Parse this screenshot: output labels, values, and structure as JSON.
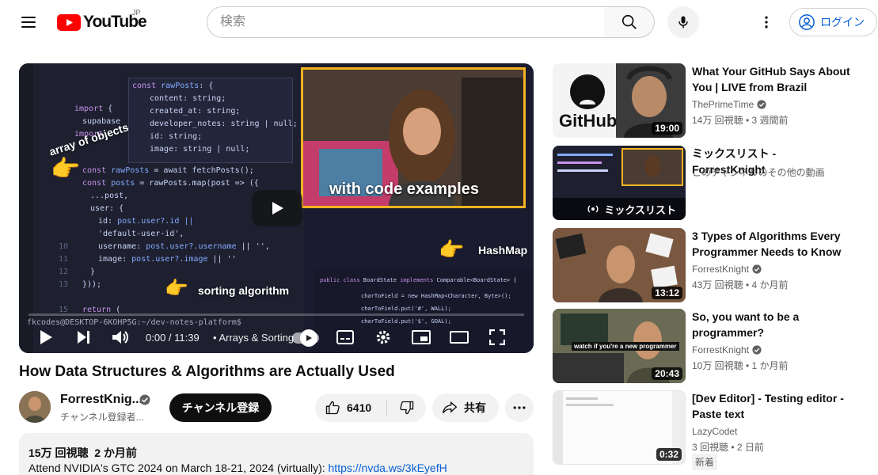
{
  "header": {
    "logo_text": "YouTube",
    "region": "JP",
    "search_placeholder": "検索",
    "login_label": "ログイン"
  },
  "player": {
    "overlay": {
      "array_label": "array of objects",
      "code_examples_label": "with code examples",
      "hashmap_label": "HashMap",
      "sorting_label": "sorting algorithm"
    },
    "time": "0:00 / 11:39",
    "chapter": "• Arrays & Sorting",
    "progress": 0,
    "terminal_prompt": "fkcodes@DESKTOP-6KOHP5G:~/dev-notes-platform$"
  },
  "video": {
    "title": "How Data Structures & Algorithms are Actually Used",
    "channel_name": "ForrestKnig...",
    "channel_subs": "チャンネル登録者...",
    "subscribe_label": "チャンネル登録",
    "like_count": "6410",
    "share_label": "共有"
  },
  "description": {
    "stats_views": "15万 回視聴",
    "stats_date": "2 か月前",
    "line_text": "Attend NVIDIA's GTC 2024 on March 18-21, 2024 (virtually): ",
    "line_link": "https://nvda.ws/3kEyefH"
  },
  "recommendations": [
    {
      "title": "What Your GitHub Says About You | LIVE from Brazil",
      "channel": "ThePrimeTime",
      "verified": true,
      "meta": "14万 回視聴 • 3 週間前",
      "duration": "19:00",
      "thumb_text": "GitHub"
    },
    {
      "title": "ミックスリスト - ForrestKnight",
      "channel": "このチャンネルのその他の動画",
      "verified": false,
      "meta": "",
      "mix_label": "ミックスリスト"
    },
    {
      "title": "3 Types of Algorithms Every Programmer Needs to Know",
      "channel": "ForrestKnight",
      "verified": true,
      "meta": "43万 回視聴 • 4 か月前",
      "duration": "13:12"
    },
    {
      "title": "So, you want to be a programmer?",
      "channel": "ForrestKnight",
      "verified": true,
      "meta": "10万 回視聴 • 1 か月前",
      "duration": "20:43",
      "thumb_text": "watch if you're a new programmer"
    },
    {
      "title": "[Dev Editor] - Testing editor - Paste text",
      "channel": "LazyCodet",
      "verified": false,
      "meta": "3 回視聴 • 2 日前",
      "duration": "0:32",
      "badge": "新着"
    }
  ],
  "colors": {
    "youtube_red": "#ff0000",
    "link_blue": "#065fd4",
    "thumb_border_yellow": "#f5b321"
  }
}
